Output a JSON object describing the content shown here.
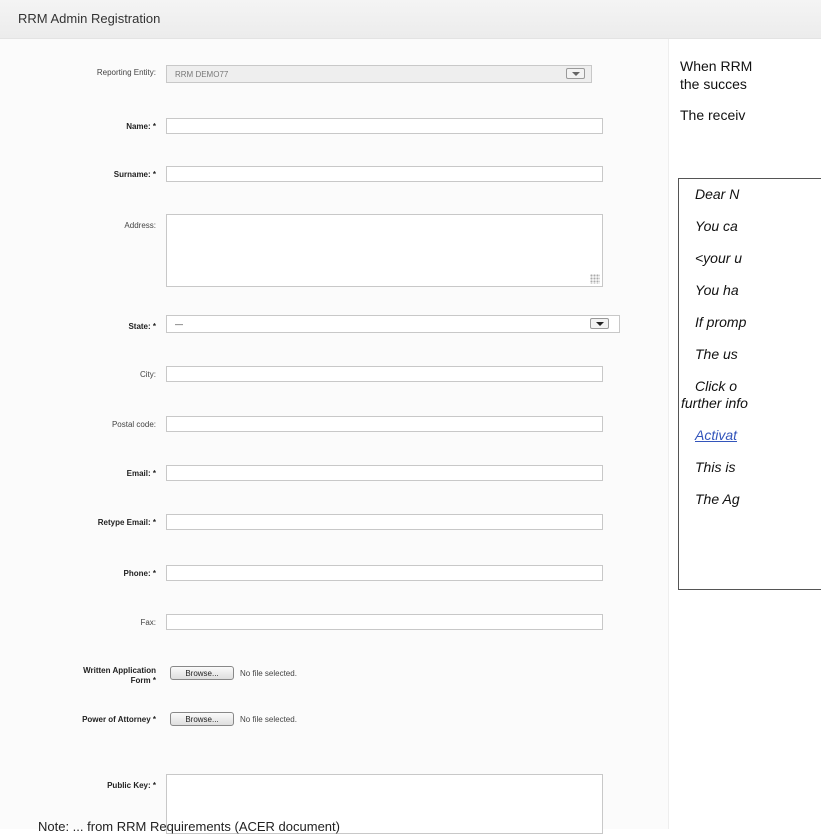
{
  "header": {
    "title": "RRM Admin Registration"
  },
  "form": {
    "reporting_entity": {
      "label": "Reporting Entity:",
      "value": "RRM DEMO77"
    },
    "name": {
      "label": "Name: *"
    },
    "surname": {
      "label": "Surname: *"
    },
    "address": {
      "label": "Address:"
    },
    "state": {
      "label": "State: *",
      "value": "—"
    },
    "city": {
      "label": "City:"
    },
    "postal_code": {
      "label": "Postal code:"
    },
    "email": {
      "label": "Email: *"
    },
    "retype_email": {
      "label": "Retype Email: *"
    },
    "phone": {
      "label": "Phone: *"
    },
    "fax": {
      "label": "Fax:"
    },
    "written_application": {
      "label_line1": "Written Application",
      "label_line2": "Form *",
      "button": "Browse...",
      "status": "No file selected."
    },
    "power_of_attorney": {
      "label": "Power of Attorney *",
      "button": "Browse...",
      "status": "No file selected."
    },
    "public_key": {
      "label": "Public Key: *"
    }
  },
  "doc": {
    "intro_line1": "When RRM",
    "intro_line2": "the succes",
    "received": "The receiv",
    "email_lines": [
      "Dear N",
      "You ca",
      "<your u",
      "You ha",
      "If promp",
      "The us",
      "Click o",
      "further info",
      "Activat",
      "This is",
      "The Ag"
    ]
  },
  "bottom_note": "Note: ... from RRM Requirements (ACER document)"
}
